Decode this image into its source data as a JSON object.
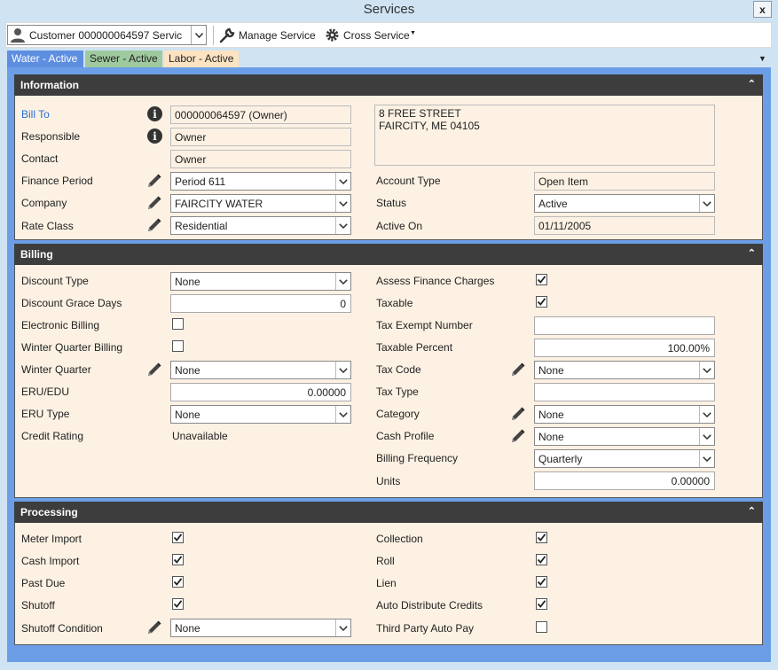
{
  "window": {
    "title": "Services",
    "close_label": "x"
  },
  "toolbar": {
    "customer_combo": "Customer 000000064597  Servic",
    "manage_service": "Manage Service",
    "cross_service": "Cross Service"
  },
  "tabs": [
    {
      "label": "Water - Active",
      "color": "#5d8ee0"
    },
    {
      "label": "Sewer - Active",
      "color": "#9fc99e"
    },
    {
      "label": "Labor - Active",
      "color": "#fde3c2"
    }
  ],
  "information": {
    "title": "Information",
    "bill_to_label": "Bill To",
    "bill_to_value": "000000064597 (Owner)",
    "responsible_label": "Responsible",
    "responsible_value": "Owner",
    "contact_label": "Contact",
    "contact_value": "Owner",
    "finance_period_label": "Finance Period",
    "finance_period_value": "Period 611",
    "company_label": "Company",
    "company_value": "FAIRCITY WATER",
    "rate_class_label": "Rate Class",
    "rate_class_value": "Residential",
    "address_line1": "8 FREE STREET",
    "address_line2": "FAIRCITY, ME 04105",
    "account_type_label": "Account Type",
    "account_type_value": "Open Item",
    "status_label": "Status",
    "status_value": "Active",
    "active_on_label": "Active On",
    "active_on_value": "01/11/2005"
  },
  "billing": {
    "title": "Billing",
    "discount_type_label": "Discount Type",
    "discount_type_value": "None",
    "discount_grace_days_label": "Discount Grace Days",
    "discount_grace_days_value": "0",
    "electronic_billing_label": "Electronic Billing",
    "electronic_billing_checked": false,
    "winter_quarter_billing_label": "Winter Quarter Billing",
    "winter_quarter_billing_checked": false,
    "winter_quarter_label": "Winter Quarter",
    "winter_quarter_value": "None",
    "eru_edu_label": "ERU/EDU",
    "eru_edu_value": "0.00000",
    "eru_type_label": "ERU Type",
    "eru_type_value": "None",
    "credit_rating_label": "Credit Rating",
    "credit_rating_value": "Unavailable",
    "assess_finance_charges_label": "Assess Finance Charges",
    "assess_finance_charges_checked": true,
    "taxable_label": "Taxable",
    "taxable_checked": true,
    "tax_exempt_number_label": "Tax Exempt Number",
    "tax_exempt_number_value": "",
    "taxable_percent_label": "Taxable Percent",
    "taxable_percent_value": "100.00%",
    "tax_code_label": "Tax Code",
    "tax_code_value": "None",
    "tax_type_label": "Tax Type",
    "tax_type_value": "",
    "category_label": "Category",
    "category_value": "None",
    "cash_profile_label": "Cash Profile",
    "cash_profile_value": "None",
    "billing_frequency_label": "Billing Frequency",
    "billing_frequency_value": "Quarterly",
    "units_label": "Units",
    "units_value": "0.00000"
  },
  "processing": {
    "title": "Processing",
    "meter_import_label": "Meter Import",
    "meter_import_checked": true,
    "cash_import_label": "Cash Import",
    "cash_import_checked": true,
    "past_due_label": "Past Due",
    "past_due_checked": true,
    "shutoff_label": "Shutoff",
    "shutoff_checked": true,
    "shutoff_condition_label": "Shutoff Condition",
    "shutoff_condition_value": "None",
    "collection_label": "Collection",
    "collection_checked": true,
    "roll_label": "Roll",
    "roll_checked": true,
    "lien_label": "Lien",
    "lien_checked": true,
    "auto_distribute_credits_label": "Auto Distribute Credits",
    "auto_distribute_credits_checked": true,
    "third_party_auto_pay_label": "Third Party Auto Pay",
    "third_party_auto_pay_checked": false
  },
  "icons": {
    "info": "info-icon",
    "edit": "pencil-icon",
    "check": "checkmark-icon",
    "dropdown": "chevron-down-icon",
    "collapse": "double-chevron-up-icon"
  }
}
